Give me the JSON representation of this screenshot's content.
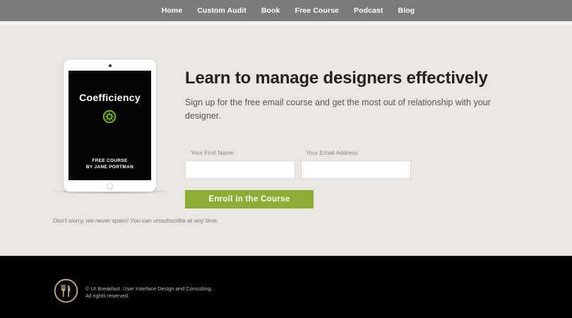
{
  "nav": {
    "items": [
      {
        "label": "Home"
      },
      {
        "label": "Custom Audit"
      },
      {
        "label": "Book"
      },
      {
        "label": "Free Course"
      },
      {
        "label": "Podcast"
      },
      {
        "label": "Blog"
      }
    ]
  },
  "tablet": {
    "title": "Coefficiency",
    "course_line1": "FREE COURSE",
    "course_line2": "BY JANE PORTMAN",
    "logo_icon": "gear-icon",
    "logo_color": "#7ab800"
  },
  "hero": {
    "headline": "Learn to manage designers effectively",
    "subtext": "Sign up for the free email course and get the most out of relationship with your designer."
  },
  "form": {
    "first_name_label": "Your First Name",
    "first_name_value": "",
    "email_label": "Your Email Address",
    "email_value": "",
    "button_label": "Enroll in the Course",
    "button_color": "#8bae33",
    "disclaimer": "Don't worry, we never spam! You can unsubscribe at any time."
  },
  "footer": {
    "logo_icon": "fork-knife-icon",
    "logo_color": "#c4a37a",
    "line1": "© UI Breakfast. User Interface Design and Consulting.",
    "line2": "All rights reserved."
  }
}
